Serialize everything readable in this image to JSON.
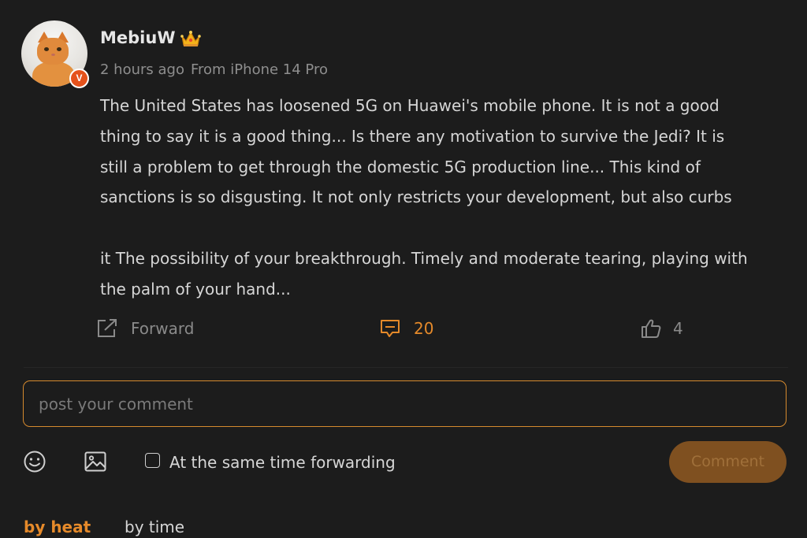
{
  "post": {
    "username": "MebiuW",
    "verified_badge": "V",
    "crown_icon": "crown-icon",
    "time": "2 hours ago",
    "source": "From iPhone 14 Pro",
    "paragraphs": [
      "The United States has loosened 5G on Huawei's mobile phone. It is not a good",
      "thing to say it is a good thing... Is there any motivation to survive the Jedi? It is",
      "still a problem to get through the domestic 5G production line... This kind of",
      "sanctions is so disgusting. It not only restricts your development, but also curbs",
      "",
      "it The possibility of your breakthrough. Timely and moderate tearing, playing with",
      "the palm of your hand..."
    ]
  },
  "actions": {
    "forward_label": "Forward",
    "comment_count": "20",
    "like_count": "4"
  },
  "composer": {
    "placeholder": "post your comment",
    "forward_checkbox_label": "At the same time forwarding",
    "submit_label": "Comment"
  },
  "sort": {
    "heat_label": "by heat",
    "time_label": "by time"
  },
  "colors": {
    "accent": "#e68a2a",
    "background": "#1c1c1c",
    "badge": "#e5521b"
  }
}
